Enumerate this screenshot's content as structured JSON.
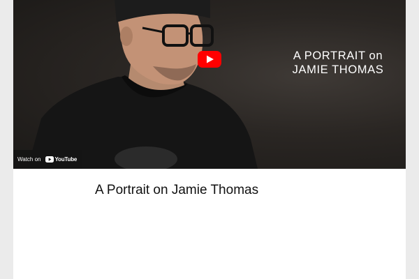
{
  "video": {
    "overlay_title_line1": "A PORTRAIT on",
    "overlay_title_line2": "JAMIE THOMAS",
    "watch_on_label": "Watch on",
    "youtube_wordmark": "YouTube",
    "play_icon": "youtube-play-icon"
  },
  "caption": {
    "title": "A Portrait on Jamie Thomas"
  },
  "colors": {
    "youtube_red": "#ff0000",
    "page_background": "#ebebeb",
    "content_background": "#ffffff"
  }
}
